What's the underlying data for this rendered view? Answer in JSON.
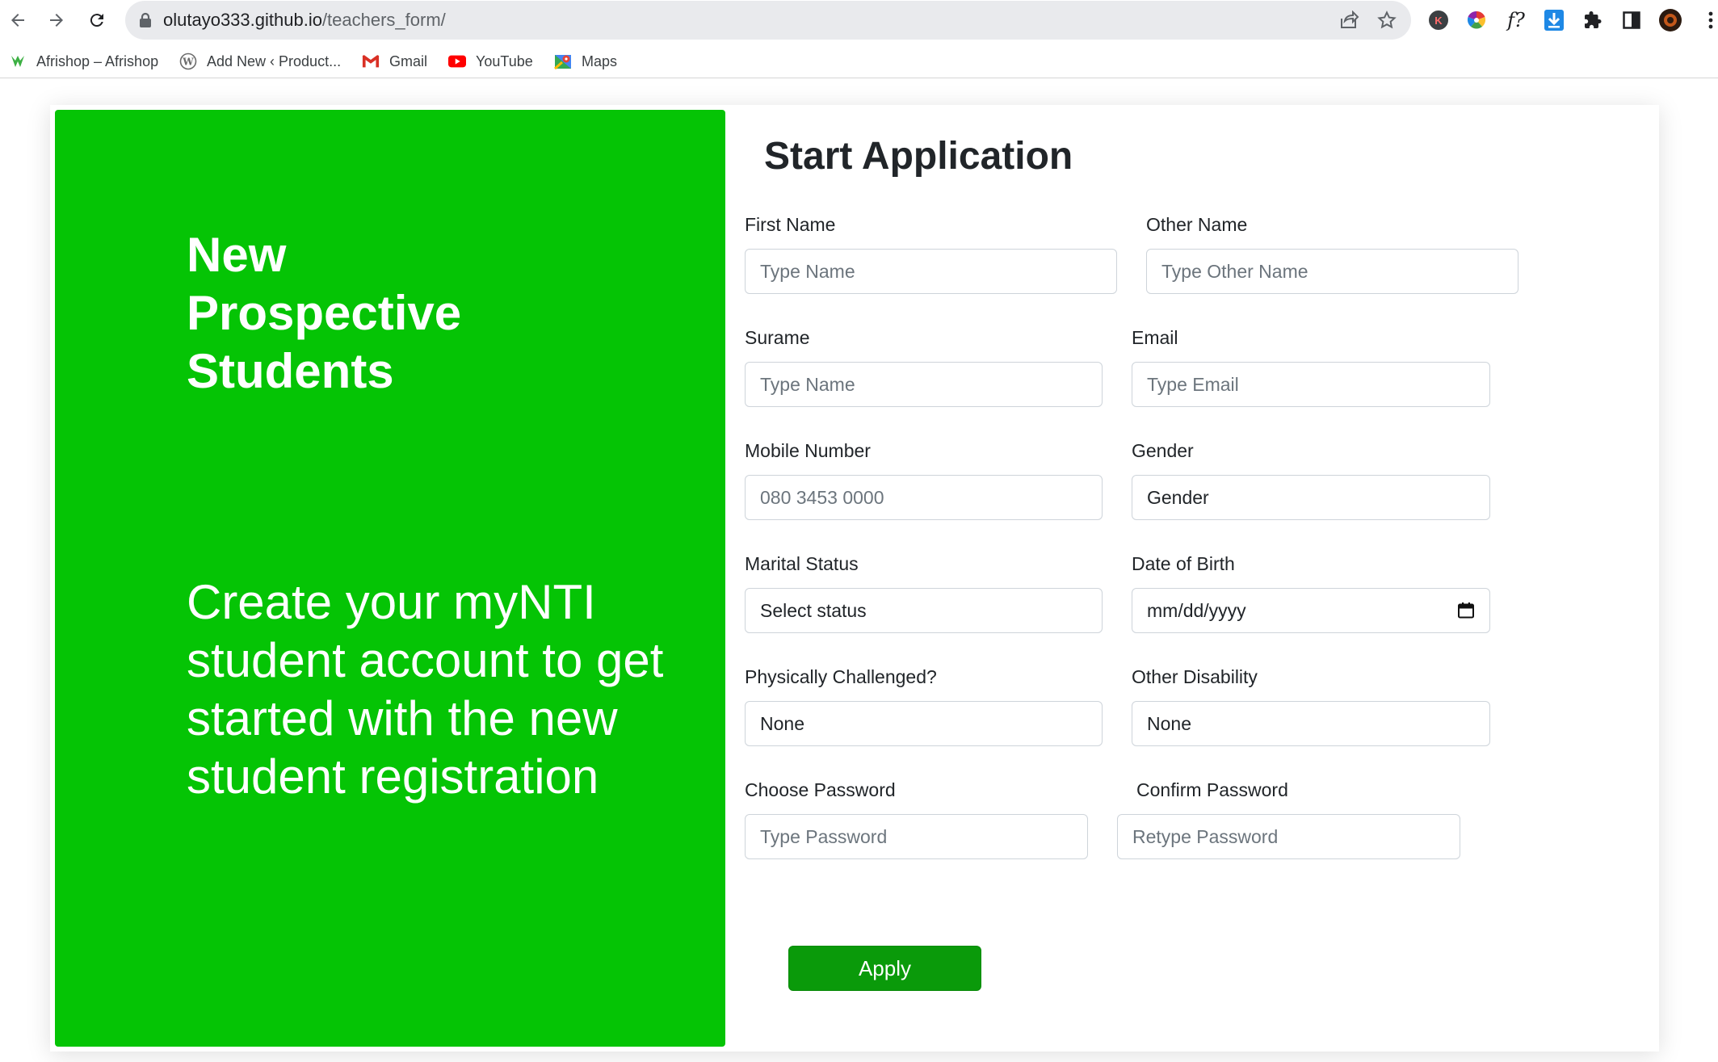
{
  "browser": {
    "url_domain": "olutayo333.github.io",
    "url_path": "/teachers_form/",
    "bookmarks": [
      {
        "label": "Afrishop – Afrishop",
        "icon": "afrishop-icon"
      },
      {
        "label": "Add New ‹ Product...",
        "icon": "wordpress-icon"
      },
      {
        "label": "Gmail",
        "icon": "gmail-icon"
      },
      {
        "label": "YouTube",
        "icon": "youtube-icon"
      },
      {
        "label": "Maps",
        "icon": "maps-icon"
      }
    ]
  },
  "hero": {
    "heading": "New\nProspective\nStudents",
    "description": "Create your myNTI student account to get started with the new student registration",
    "background_color": "#05c405"
  },
  "form": {
    "title": "Start Application",
    "first_name": {
      "label": "First Name",
      "placeholder": "Type Name"
    },
    "other_name": {
      "label": "Other Name",
      "placeholder": "Type Other Name"
    },
    "surname": {
      "label": "Surame",
      "placeholder": "Type Name"
    },
    "email": {
      "label": "Email",
      "placeholder": "Type Email"
    },
    "mobile": {
      "label": "Mobile Number",
      "placeholder": "080 3453 0000"
    },
    "gender": {
      "label": "Gender",
      "value": "Gender"
    },
    "marital_status": {
      "label": "Marital Status",
      "value": "Select status"
    },
    "dob": {
      "label": "Date of Birth",
      "value": "mm/dd/yyyy"
    },
    "physically_challenged": {
      "label": "Physically Challenged?",
      "value": "None"
    },
    "other_disability": {
      "label": "Other Disability",
      "value": "None"
    },
    "choose_password": {
      "label": "Choose Password",
      "placeholder": "Type Password"
    },
    "confirm_password": {
      "label": "Confirm Password",
      "placeholder": "Retype Password"
    },
    "apply_label": "Apply",
    "apply_color": "#0a9a0a"
  }
}
